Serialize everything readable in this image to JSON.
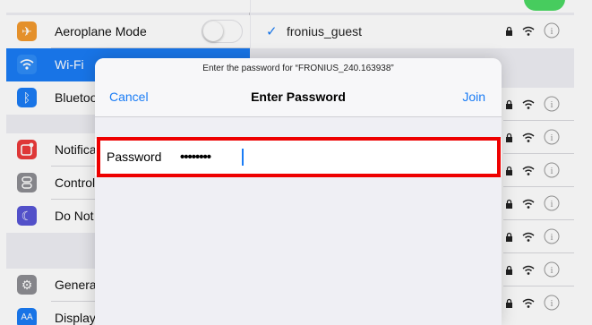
{
  "settings": {
    "items": [
      {
        "label": "Aeroplane Mode",
        "icon": "airplane-icon",
        "color": "#f39a2e",
        "glyph": "✈"
      },
      {
        "label": "Wi-Fi",
        "icon": "wifi-icon",
        "color": "#1a7cf5",
        "glyph": ""
      },
      {
        "label": "Bluetoo",
        "icon": "bluetooth-icon",
        "color": "#1a7cf5",
        "glyph": "ᛒ"
      },
      {
        "label": "Notifica",
        "icon": "notifications-icon",
        "color": "#ec3b3b",
        "glyph": ""
      },
      {
        "label": "Control",
        "icon": "control-centre-icon",
        "color": "#8e8e93",
        "glyph": ""
      },
      {
        "label": "Do Not",
        "icon": "do-not-disturb-icon",
        "color": "#5856d6",
        "glyph": "☾"
      },
      {
        "label": "Genera",
        "icon": "general-gear-icon",
        "color": "#8e8e93",
        "glyph": "⚙"
      },
      {
        "label": "Display",
        "icon": "display-icon",
        "color": "#1a7cf5",
        "glyph": "AA"
      }
    ]
  },
  "networks": {
    "connected": "fronius_guest"
  },
  "dialog": {
    "prompt": "Enter the password for “FRONIUS_240.163938”",
    "cancel_label": "Cancel",
    "title": "Enter Password",
    "join_label": "Join",
    "password_label": "Password",
    "password_value": "••••••••"
  },
  "colors": {
    "accent": "#1a7cf5",
    "highlight_border": "#ee0000"
  }
}
